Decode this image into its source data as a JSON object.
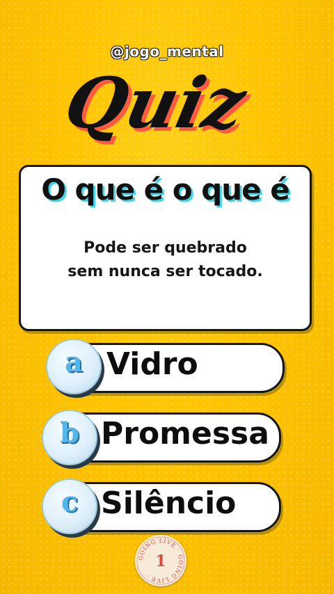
{
  "brand": {
    "handle": "@jogo_mental",
    "logo_text": "Quiz"
  },
  "question_card": {
    "title": "O que é o que é",
    "question_lines": [
      "Pode ser quebrado",
      "sem nunca ser tocado."
    ]
  },
  "options": [
    {
      "letter": "a",
      "label": "Vidro"
    },
    {
      "letter": "b",
      "label": "Promessa"
    },
    {
      "letter": "c",
      "label": "Silêncio"
    }
  ],
  "stamp": {
    "number": "1",
    "ring_text": "GOING LIVE · GOING LIVE ·"
  },
  "colors": {
    "background": "#ffc400",
    "title_shadow": "#3fd4e6",
    "badge_letter": "#55b6ec",
    "logo_shadow": "#ff5a3c"
  }
}
